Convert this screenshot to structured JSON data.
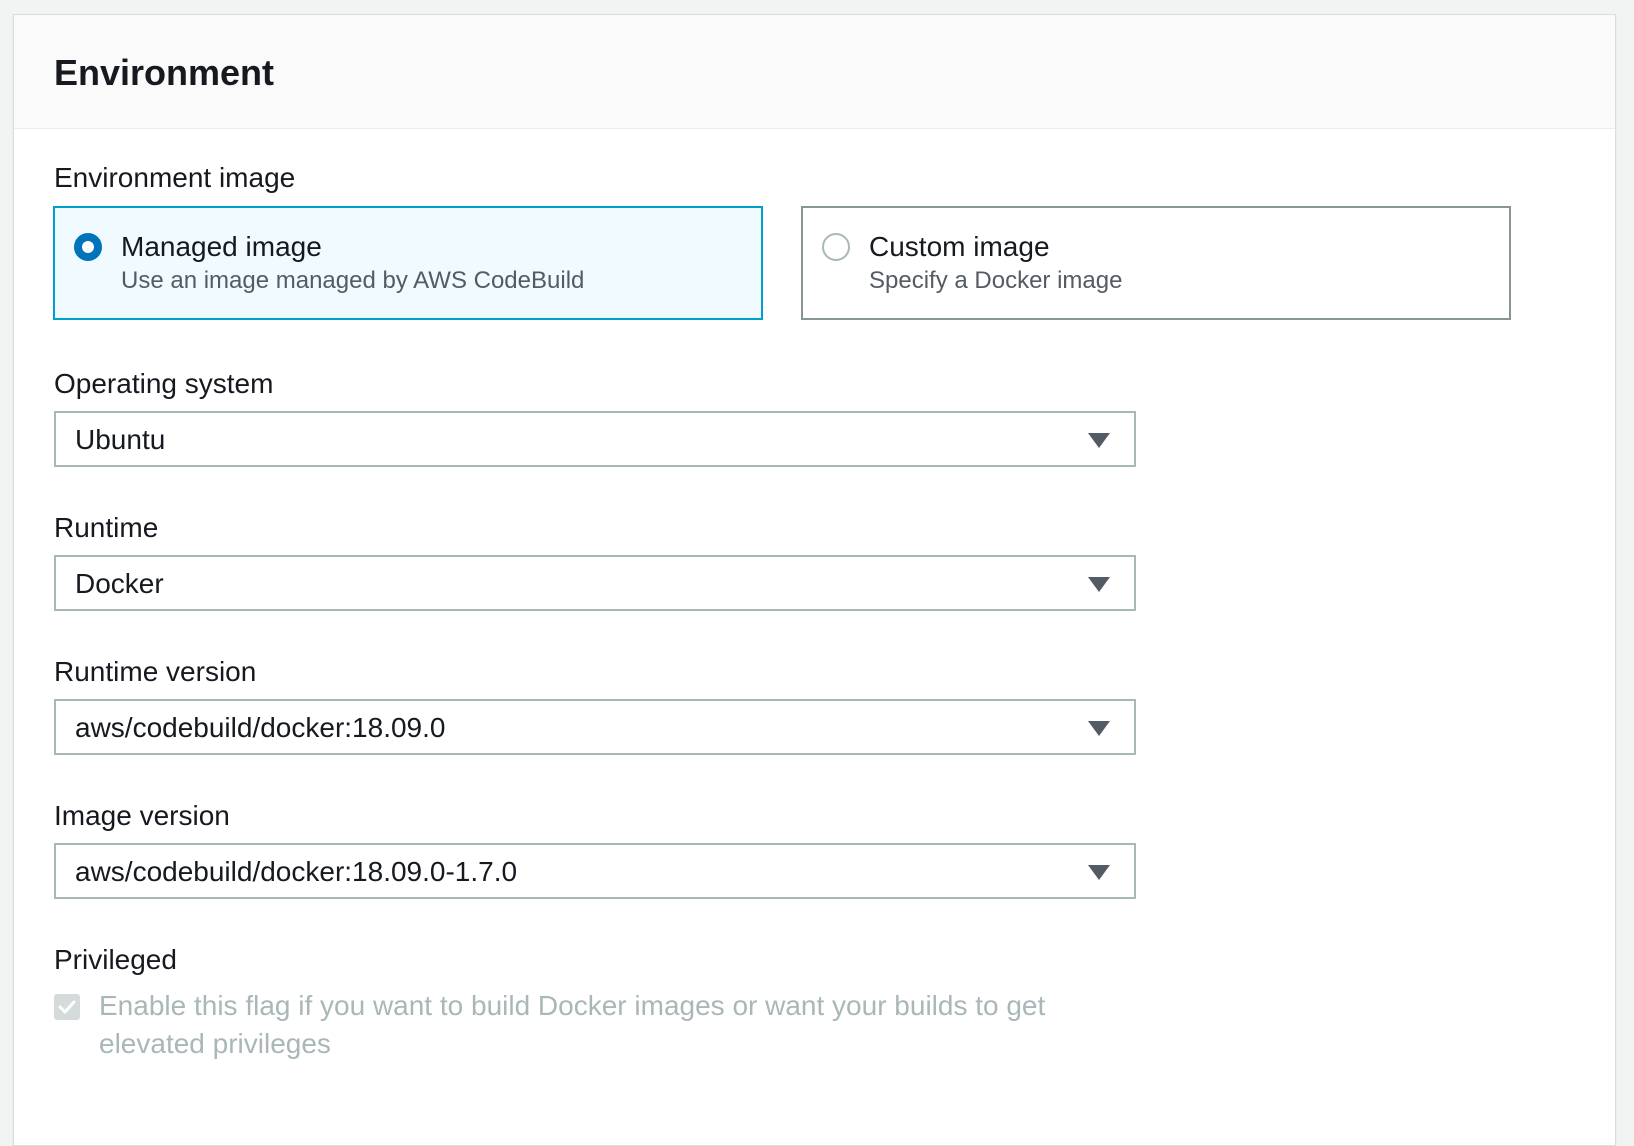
{
  "panel": {
    "title": "Environment"
  },
  "environment_image": {
    "label": "Environment image",
    "options": [
      {
        "title": "Managed image",
        "description": "Use an image managed by AWS CodeBuild",
        "selected": true
      },
      {
        "title": "Custom image",
        "description": "Specify a Docker image",
        "selected": false
      }
    ]
  },
  "operating_system": {
    "label": "Operating system",
    "value": "Ubuntu"
  },
  "runtime": {
    "label": "Runtime",
    "value": "Docker"
  },
  "runtime_version": {
    "label": "Runtime version",
    "value": "aws/codebuild/docker:18.09.0"
  },
  "image_version": {
    "label": "Image version",
    "value": "aws/codebuild/docker:18.09.0-1.7.0"
  },
  "privileged": {
    "label": "Privileged",
    "checkbox_text": "Enable this flag if you want to build Docker images or want your builds to get elevated privileges",
    "checked": true,
    "disabled": true
  },
  "icons": {
    "dropdown": "caret-down-icon",
    "checkbox": "checkmark-icon"
  },
  "colors": {
    "selected_border": "#00a1c9",
    "selected_background": "#f1faff",
    "radio_checked": "#0073bb",
    "disabled_text": "#aab7b8"
  }
}
